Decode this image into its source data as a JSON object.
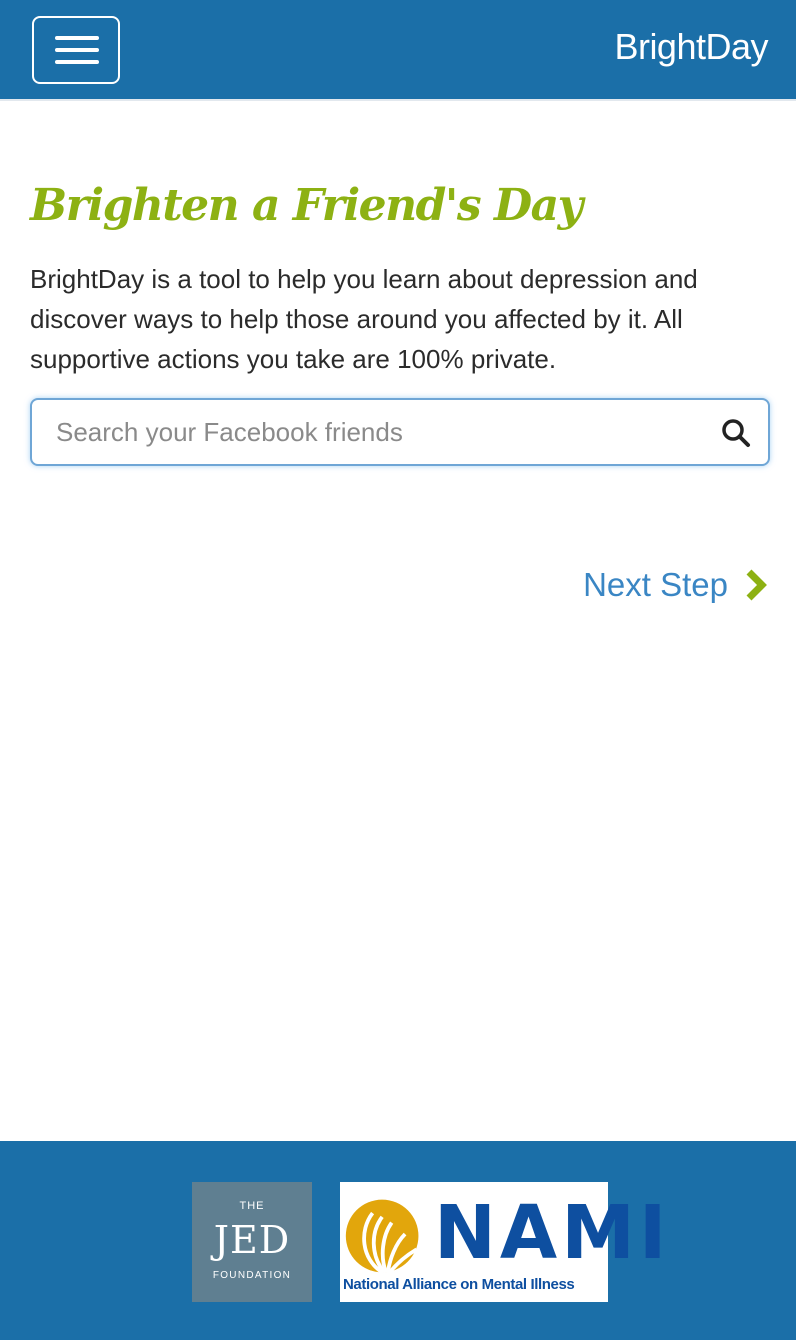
{
  "header": {
    "brand": "BrightDay",
    "menu_icon": "hamburger-menu-icon"
  },
  "main": {
    "heading": "Brighten a Friend's Day",
    "intro": "BrightDay is a tool to help you learn about depression and discover ways to help those around you affected by it. All supportive actions you take are 100% private.",
    "search": {
      "placeholder": "Search your Facebook friends",
      "value": "",
      "icon": "search-icon"
    },
    "next_step": {
      "label": "Next Step",
      "icon": "chevron-right-icon"
    }
  },
  "footer": {
    "logos": {
      "jed": {
        "the": "THE",
        "name": "JED",
        "sub": "FOUNDATION"
      },
      "nami": {
        "name": "NAMI",
        "tagline": "National Alliance on Mental Illness"
      }
    }
  },
  "colors": {
    "header_bg": "#1b6fa8",
    "heading": "#8db113",
    "link": "#3a86c4",
    "chevron": "#8db113",
    "nami_blue": "#0e4fa0",
    "nami_gold": "#e2a60c"
  }
}
